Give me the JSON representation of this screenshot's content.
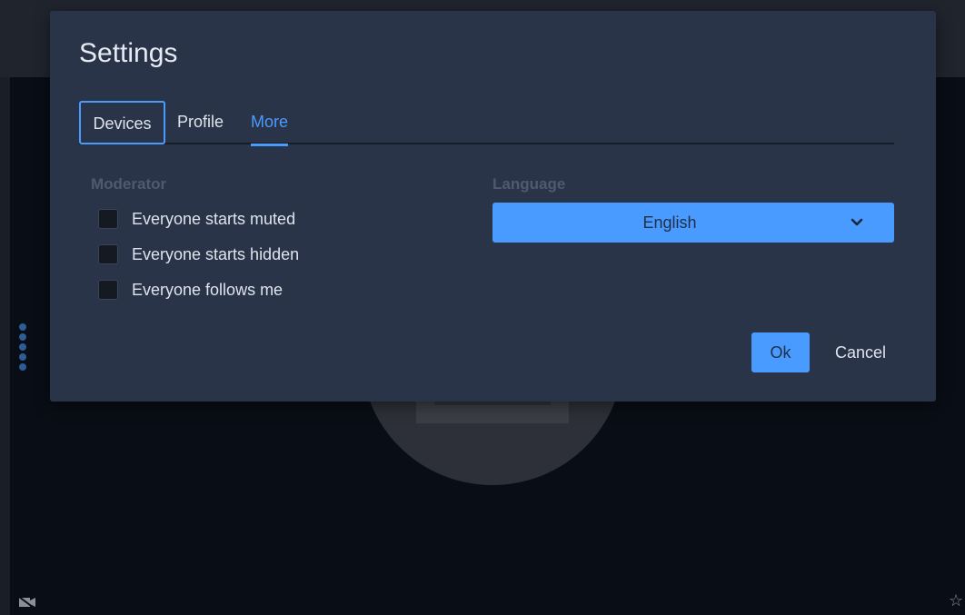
{
  "dialog": {
    "title": "Settings",
    "tabs": [
      {
        "label": "Devices",
        "state": "focused"
      },
      {
        "label": "Profile",
        "state": "normal"
      },
      {
        "label": "More",
        "state": "selected"
      }
    ],
    "moderator": {
      "label": "Moderator",
      "options": [
        {
          "label": "Everyone starts muted",
          "checked": false
        },
        {
          "label": "Everyone starts hidden",
          "checked": false
        },
        {
          "label": "Everyone follows me",
          "checked": false
        }
      ]
    },
    "language": {
      "label": "Language",
      "selected": "English"
    },
    "buttons": {
      "ok": "Ok",
      "cancel": "Cancel"
    }
  },
  "background": {
    "icons": [
      "video-off-icon",
      "star-icon",
      "drag-handle-icon"
    ],
    "star_glyph": "☆"
  },
  "colors": {
    "accent": "#4a9bff",
    "dialog_bg": "#293448",
    "muted_label": "#4e5a6f"
  }
}
